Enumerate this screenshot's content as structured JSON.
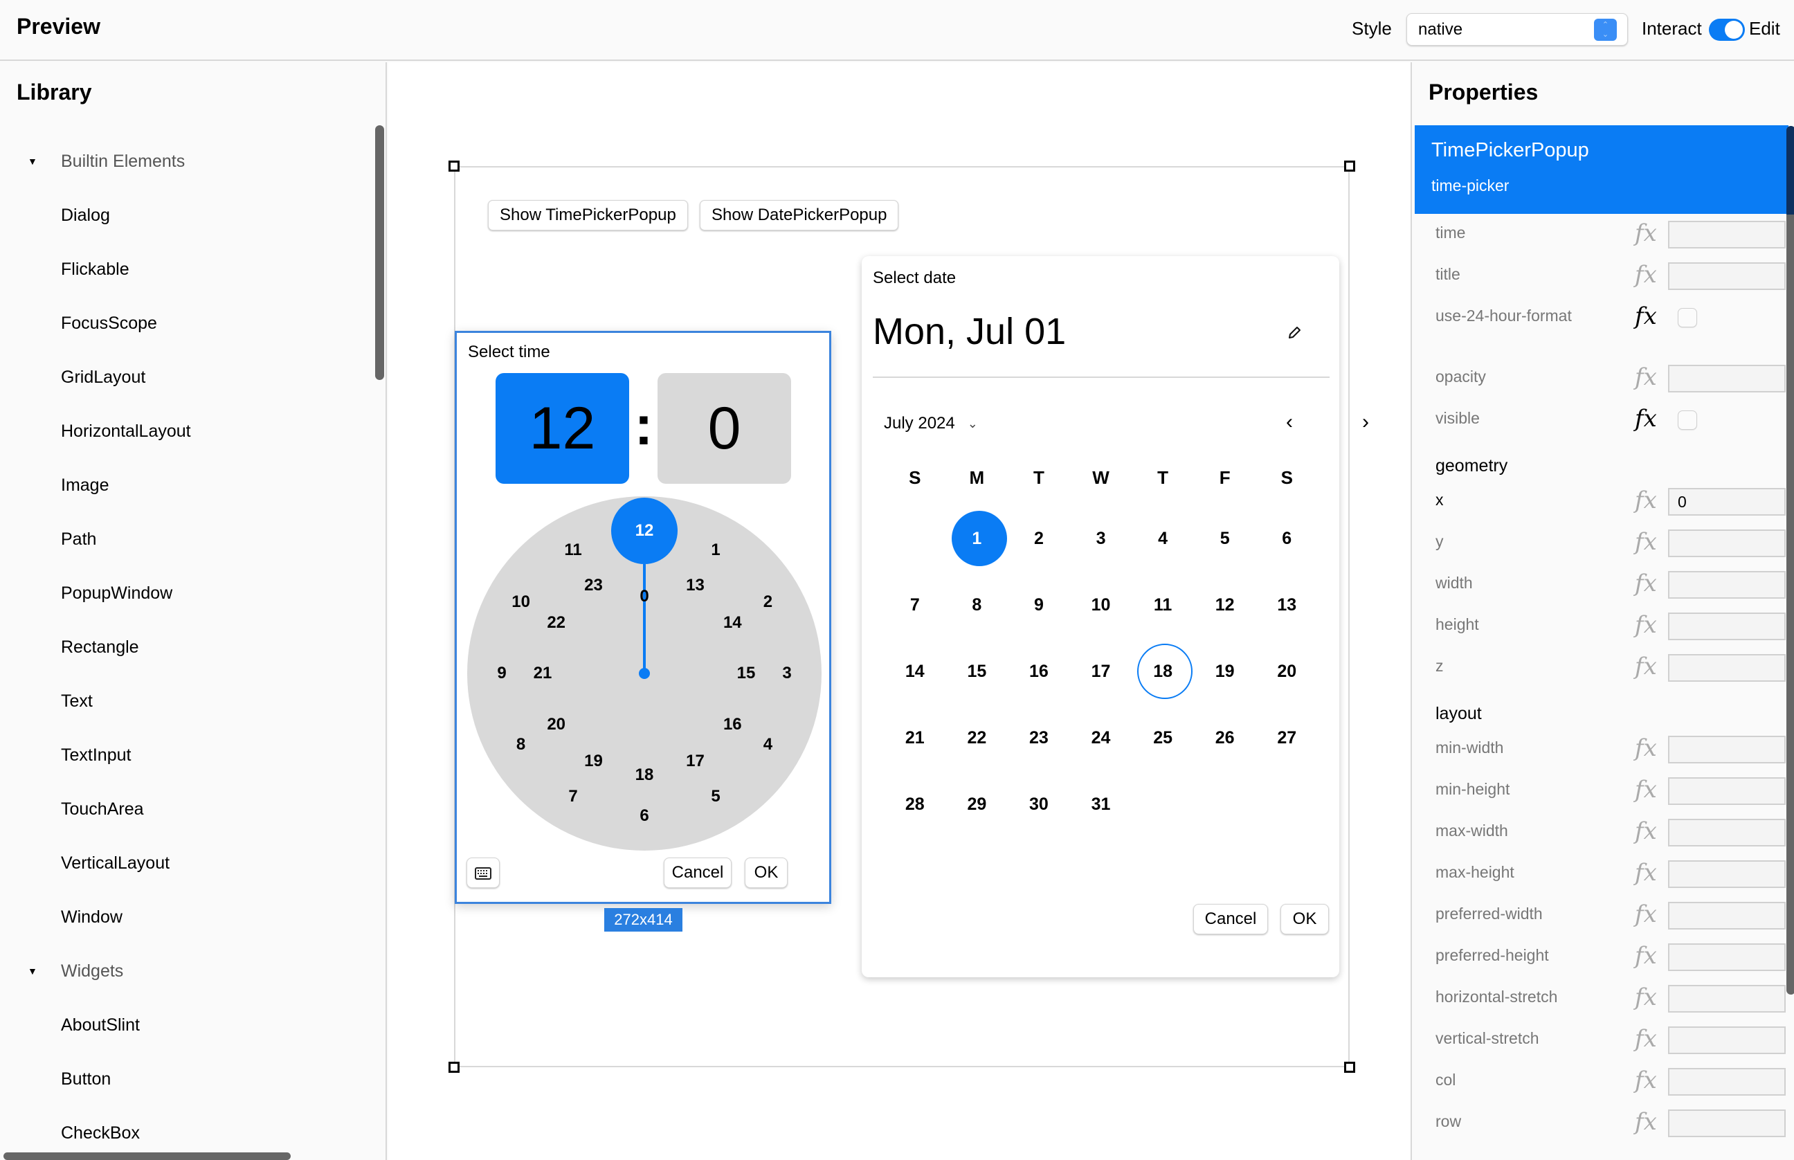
{
  "topbar": {
    "title": "Preview",
    "style_label": "Style",
    "style_value": "native",
    "interact_label": "Interact",
    "edit_label": "Edit",
    "mode_toggle_on": true
  },
  "library": {
    "title": "Library",
    "groups": [
      {
        "label": "Builtin Elements",
        "expanded": true,
        "items": [
          "Dialog",
          "Flickable",
          "FocusScope",
          "GridLayout",
          "HorizontalLayout",
          "Image",
          "Path",
          "PopupWindow",
          "Rectangle",
          "Text",
          "TextInput",
          "TouchArea",
          "VerticalLayout",
          "Window"
        ]
      },
      {
        "label": "Widgets",
        "expanded": true,
        "items": [
          "AboutSlint",
          "Button",
          "CheckBox"
        ]
      }
    ]
  },
  "canvas": {
    "buttons": {
      "show_time": "Show TimePickerPopup",
      "show_date": "Show DatePickerPopup"
    },
    "selection_size": "272x414",
    "time_picker": {
      "title": "Select time",
      "hour": "12",
      "separator": ":",
      "minute": "0",
      "selected_hour": "12",
      "outer_ring": [
        "12",
        "1",
        "2",
        "3",
        "4",
        "5",
        "6",
        "7",
        "8",
        "9",
        "10",
        "11"
      ],
      "inner_ring": [
        "0",
        "13",
        "14",
        "15",
        "16",
        "17",
        "18",
        "19",
        "20",
        "21",
        "22",
        "23"
      ],
      "keyboard_icon": "keyboard-icon",
      "cancel": "Cancel",
      "ok": "OK"
    },
    "date_picker": {
      "title": "Select date",
      "selected_date": "Mon, Jul 01",
      "edit_icon": "pencil-icon",
      "month_label": "July 2024",
      "weekdays": [
        "S",
        "M",
        "T",
        "W",
        "T",
        "F",
        "S"
      ],
      "weeks": [
        [
          "",
          "1",
          "2",
          "3",
          "4",
          "5",
          "6"
        ],
        [
          "7",
          "8",
          "9",
          "10",
          "11",
          "12",
          "13"
        ],
        [
          "14",
          "15",
          "16",
          "17",
          "18",
          "19",
          "20"
        ],
        [
          "21",
          "22",
          "23",
          "24",
          "25",
          "26",
          "27"
        ],
        [
          "28",
          "29",
          "30",
          "31",
          "",
          "",
          ""
        ]
      ],
      "selected_day": "1",
      "today": "18",
      "cancel": "Cancel",
      "ok": "OK"
    }
  },
  "properties": {
    "title": "Properties",
    "element_type": "TimePickerPopup",
    "element_id": "time-picker",
    "rows": [
      {
        "kind": "prop",
        "label": "time",
        "control": "input",
        "value": "",
        "bound": false
      },
      {
        "kind": "prop",
        "label": "title",
        "control": "input",
        "value": "",
        "bound": false
      },
      {
        "kind": "prop",
        "label": "use-24-hour-format",
        "control": "checkbox",
        "checked": false,
        "bound": true
      },
      {
        "kind": "spacer"
      },
      {
        "kind": "prop",
        "label": "opacity",
        "control": "input",
        "value": "",
        "bound": false
      },
      {
        "kind": "prop",
        "label": "visible",
        "control": "checkbox",
        "checked": false,
        "bound": true
      },
      {
        "kind": "section",
        "label": "geometry"
      },
      {
        "kind": "prop",
        "label": "x",
        "control": "input",
        "value": "0",
        "bound": false,
        "set": true
      },
      {
        "kind": "prop",
        "label": "y",
        "control": "input",
        "value": "",
        "bound": false
      },
      {
        "kind": "prop",
        "label": "width",
        "control": "input",
        "value": "",
        "bound": false
      },
      {
        "kind": "prop",
        "label": "height",
        "control": "input",
        "value": "",
        "bound": false
      },
      {
        "kind": "prop",
        "label": "z",
        "control": "input",
        "value": "",
        "bound": false
      },
      {
        "kind": "section",
        "label": "layout"
      },
      {
        "kind": "prop",
        "label": "min-width",
        "control": "input",
        "value": "",
        "bound": false
      },
      {
        "kind": "prop",
        "label": "min-height",
        "control": "input",
        "value": "",
        "bound": false
      },
      {
        "kind": "prop",
        "label": "max-width",
        "control": "input",
        "value": "",
        "bound": false
      },
      {
        "kind": "prop",
        "label": "max-height",
        "control": "input",
        "value": "",
        "bound": false
      },
      {
        "kind": "prop",
        "label": "preferred-width",
        "control": "input",
        "value": "",
        "bound": false
      },
      {
        "kind": "prop",
        "label": "preferred-height",
        "control": "input",
        "value": "",
        "bound": false
      },
      {
        "kind": "prop",
        "label": "horizontal-stretch",
        "control": "input",
        "value": "",
        "bound": false
      },
      {
        "kind": "prop",
        "label": "vertical-stretch",
        "control": "input",
        "value": "",
        "bound": false
      },
      {
        "kind": "prop",
        "label": "col",
        "control": "input",
        "value": "",
        "bound": false
      },
      {
        "kind": "prop",
        "label": "row",
        "control": "input",
        "value": "",
        "bound": false
      }
    ]
  },
  "colors": {
    "accent": "#0a7cf4",
    "selection_outline": "#3c84dd",
    "clock_face": "#d9d9d9",
    "scrollbar": "#666666"
  }
}
